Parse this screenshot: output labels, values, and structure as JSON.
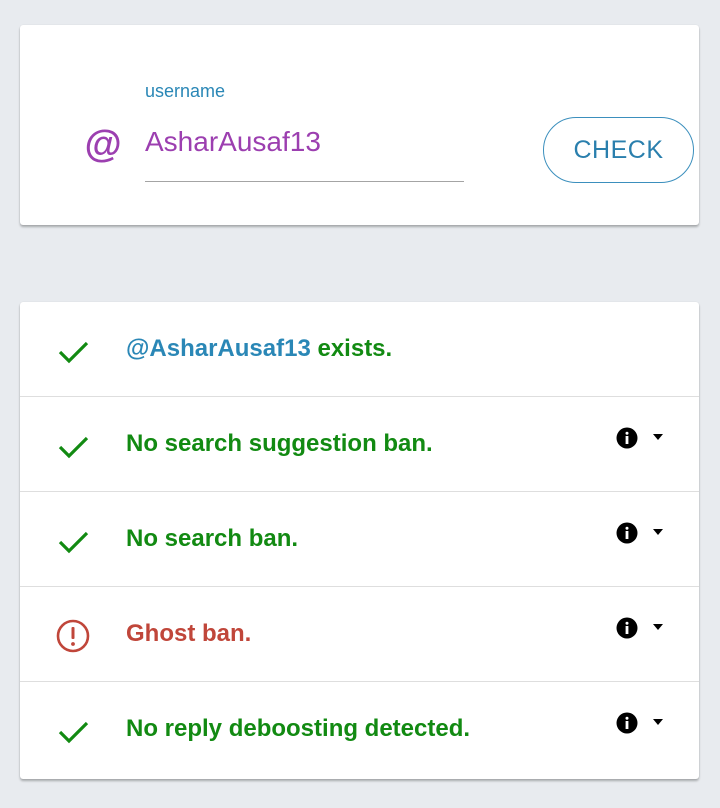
{
  "input_card": {
    "at_symbol": "@",
    "label": "username",
    "value": "AsharAusaf13",
    "button_label": "CHECK"
  },
  "results": {
    "exists": {
      "status": "ok",
      "handle": "@AsharAusaf13",
      "text": " exists."
    },
    "items": [
      {
        "status": "ok",
        "text": "No search suggestion ban."
      },
      {
        "status": "ok",
        "text": "No search ban."
      },
      {
        "status": "warning",
        "text": "Ghost ban."
      },
      {
        "status": "ok",
        "text": "No reply deboosting detected."
      }
    ]
  },
  "colors": {
    "ok": "#128a12",
    "warning": "#c0463a",
    "accent": "#2a87b6",
    "username": "#9c3fb0"
  },
  "icons": {
    "ok": "check-icon",
    "warning": "alert-circle-icon",
    "info": "info-icon",
    "expand": "caret-down-icon"
  }
}
